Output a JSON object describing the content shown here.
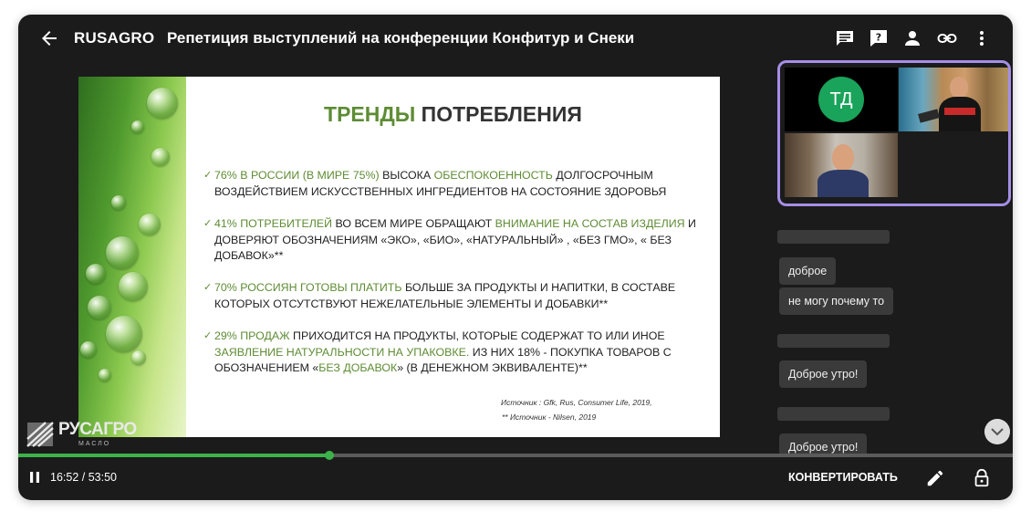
{
  "header": {
    "brand": "RUSAGRO",
    "title": "Репетиция выступлений на конференции Конфитур и Снеки"
  },
  "slide": {
    "title_accent": "ТРЕНДЫ",
    "title_rest": " ПОТРЕБЛЕНИЯ",
    "bullets": [
      {
        "g1": "76% В РОССИИ (В МИРЕ 75%)",
        "t1": " ВЫСОКА ",
        "g2": "ОБЕСПОКОЕННОСТЬ",
        "t2": " ДОЛГОСРОЧНЫМ ВОЗДЕЙСТВИЕМ ИСКУССТВЕННЫХ ИНГРЕДИЕНТОВ НА СОСТОЯНИЕ ЗДОРОВЬЯ",
        "g3": "",
        "t3": ""
      },
      {
        "g1": "41%  ПОТРЕБИТЕЛЕЙ",
        "t1": " ВО ВСЕМ МИРЕ  ОБРАЩАЮТ ",
        "g2": "ВНИМАНИЕ НА СОСТАВ ИЗДЕЛИЯ",
        "t2": "  И ДОВЕРЯЮТ ОБОЗНАЧЕНИЯМ «ЭКО», «БИО», «НАТУРАЛЬНЫЙ» , «БЕЗ ГМО», « БЕЗ ДОБАВОК»**",
        "g3": "",
        "t3": ""
      },
      {
        "g1": "70% РОССИЯН ",
        "t1": "",
        "g2": "ГОТОВЫ ПЛАТИТЬ",
        "t2": " БОЛЬШЕ ЗА ПРОДУКТЫ И НАПИТКИ, В СОСТАВЕ КОТОРЫХ ОТСУТСТВУЮТ НЕЖЕЛАТЕЛЬНЫЕ ЭЛЕМЕНТЫ И ДОБАВКИ**",
        "g3": "",
        "t3": ""
      },
      {
        "g1": "29% ПРОДАЖ",
        "t1": " ПРИХОДИТСЯ НА ПРОДУКТЫ, КОТОРЫЕ СОДЕРЖАТ ТО ИЛИ ИНОЕ ",
        "g2": "ЗАЯВЛЕНИЕ НАТУРАЛЬНОСТИ НА УПАКОВКЕ.",
        "t2": " ИЗ НИХ 18%  - ПОКУПКА ТОВАРОВ С ОБОЗНАЧЕНИЕМ «",
        "g3": "БЕЗ ДОБАВОК",
        "t3": "»  (В ДЕНЕЖНОМ ЭКВИВАЛЕНТЕ)**"
      }
    ],
    "source_1": "Источник  :   Gfk,  Rus, Consumer Life, 2019,",
    "source_2": "**  Источник -  Nilsen, 2019",
    "logo_text": "РУСАГРО",
    "logo_sub": "МАСЛО"
  },
  "participants": {
    "td_initials": "ТД",
    "avatar_color": "#1aa35a"
  },
  "chat": {
    "messages": [
      "доброе",
      "не могу почему то",
      "Доброе утро!",
      "Доброе утро!"
    ]
  },
  "player": {
    "time": "16:52 / 53:50",
    "progress_fraction": 0.313,
    "accent_color": "#3cb34a",
    "convert_label": "КОНВЕРТИРОВАТЬ"
  }
}
